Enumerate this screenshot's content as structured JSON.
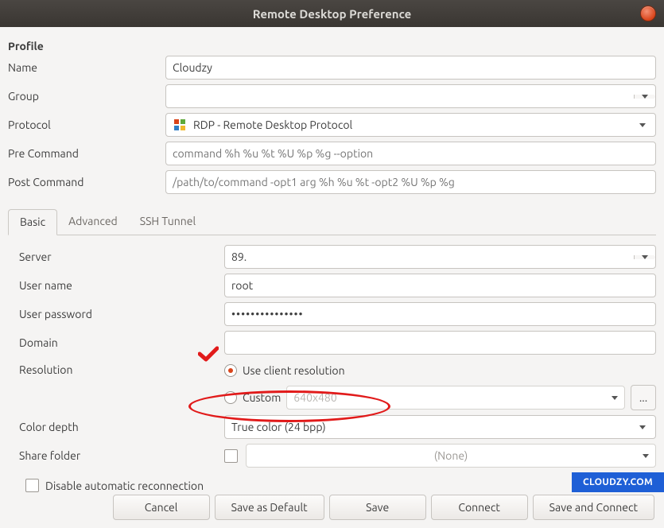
{
  "titlebar": {
    "title": "Remote Desktop Preference"
  },
  "profile": {
    "heading": "Profile",
    "name_label": "Name",
    "name_value": "Cloudzy",
    "group_label": "Group",
    "group_value": "",
    "protocol_label": "Protocol",
    "protocol_value": "RDP - Remote Desktop Protocol",
    "precmd_label": "Pre Command",
    "precmd_placeholder": "command %h %u %t %U %p %g --option",
    "precmd_value": "",
    "postcmd_label": "Post Command",
    "postcmd_placeholder": "/path/to/command -opt1 arg %h %u %t -opt2 %U %p %g",
    "postcmd_value": ""
  },
  "tabs": {
    "basic": "Basic",
    "advanced": "Advanced",
    "ssh": "SSH Tunnel"
  },
  "basic": {
    "server_label": "Server",
    "server_value": "89.",
    "username_label": "User name",
    "username_value": "root",
    "password_label": "User password",
    "password_value": "•••••••••••••••",
    "domain_label": "Domain",
    "domain_value": "",
    "resolution_label": "Resolution",
    "resolution_client": "Use client resolution",
    "resolution_custom": "Custom",
    "resolution_custom_value": "640x480",
    "more_btn": "...",
    "colordepth_label": "Color depth",
    "colordepth_value": "True color (24 bpp)",
    "sharefolder_label": "Share folder",
    "sharefolder_value": "(None)",
    "disable_auto_label": "Disable automatic reconnection",
    "disable_auto_checked": false
  },
  "footer": {
    "cancel": "Cancel",
    "save_default": "Save as Default",
    "save": "Save",
    "connect": "Connect",
    "save_connect": "Save and Connect"
  },
  "watermark": "CLOUDZY.COM"
}
